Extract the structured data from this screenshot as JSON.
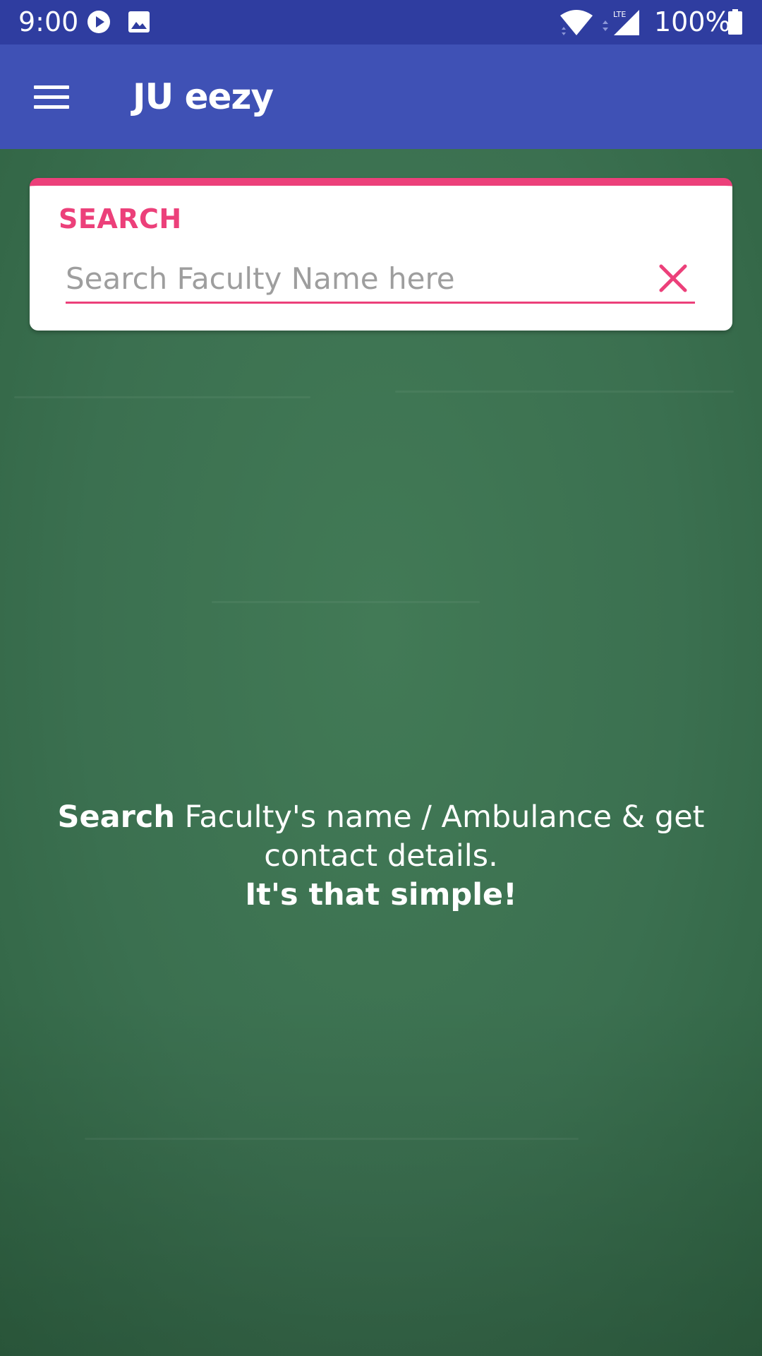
{
  "status_bar": {
    "time": "9:00",
    "battery_percent": "100%",
    "network_type": "LTE"
  },
  "app_bar": {
    "title": "JU eezy"
  },
  "search_card": {
    "heading": "SEARCH",
    "input_value": "",
    "input_placeholder": "Search Faculty Name here"
  },
  "hint": {
    "bold_lead": "Search",
    "line1_rest": " Faculty's name / Ambulance & get contact details.",
    "tagline": "It's that simple!"
  },
  "colors": {
    "status_bar": "#2f3da0",
    "app_bar": "#3f51b5",
    "accent": "#ec407a",
    "board": "#3b7050"
  }
}
